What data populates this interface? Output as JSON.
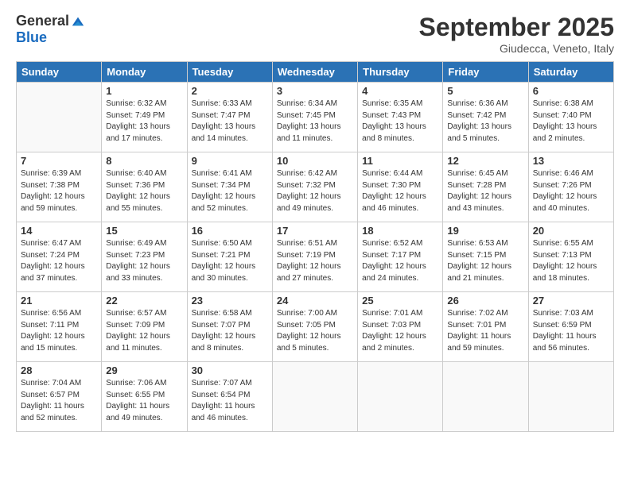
{
  "logo": {
    "general": "General",
    "blue": "Blue"
  },
  "title": "September 2025",
  "location": "Giudecca, Veneto, Italy",
  "headers": [
    "Sunday",
    "Monday",
    "Tuesday",
    "Wednesday",
    "Thursday",
    "Friday",
    "Saturday"
  ],
  "weeks": [
    [
      {
        "day": "",
        "content": ""
      },
      {
        "day": "1",
        "content": "Sunrise: 6:32 AM\nSunset: 7:49 PM\nDaylight: 13 hours\nand 17 minutes."
      },
      {
        "day": "2",
        "content": "Sunrise: 6:33 AM\nSunset: 7:47 PM\nDaylight: 13 hours\nand 14 minutes."
      },
      {
        "day": "3",
        "content": "Sunrise: 6:34 AM\nSunset: 7:45 PM\nDaylight: 13 hours\nand 11 minutes."
      },
      {
        "day": "4",
        "content": "Sunrise: 6:35 AM\nSunset: 7:43 PM\nDaylight: 13 hours\nand 8 minutes."
      },
      {
        "day": "5",
        "content": "Sunrise: 6:36 AM\nSunset: 7:42 PM\nDaylight: 13 hours\nand 5 minutes."
      },
      {
        "day": "6",
        "content": "Sunrise: 6:38 AM\nSunset: 7:40 PM\nDaylight: 13 hours\nand 2 minutes."
      }
    ],
    [
      {
        "day": "7",
        "content": "Sunrise: 6:39 AM\nSunset: 7:38 PM\nDaylight: 12 hours\nand 59 minutes."
      },
      {
        "day": "8",
        "content": "Sunrise: 6:40 AM\nSunset: 7:36 PM\nDaylight: 12 hours\nand 55 minutes."
      },
      {
        "day": "9",
        "content": "Sunrise: 6:41 AM\nSunset: 7:34 PM\nDaylight: 12 hours\nand 52 minutes."
      },
      {
        "day": "10",
        "content": "Sunrise: 6:42 AM\nSunset: 7:32 PM\nDaylight: 12 hours\nand 49 minutes."
      },
      {
        "day": "11",
        "content": "Sunrise: 6:44 AM\nSunset: 7:30 PM\nDaylight: 12 hours\nand 46 minutes."
      },
      {
        "day": "12",
        "content": "Sunrise: 6:45 AM\nSunset: 7:28 PM\nDaylight: 12 hours\nand 43 minutes."
      },
      {
        "day": "13",
        "content": "Sunrise: 6:46 AM\nSunset: 7:26 PM\nDaylight: 12 hours\nand 40 minutes."
      }
    ],
    [
      {
        "day": "14",
        "content": "Sunrise: 6:47 AM\nSunset: 7:24 PM\nDaylight: 12 hours\nand 37 minutes."
      },
      {
        "day": "15",
        "content": "Sunrise: 6:49 AM\nSunset: 7:23 PM\nDaylight: 12 hours\nand 33 minutes."
      },
      {
        "day": "16",
        "content": "Sunrise: 6:50 AM\nSunset: 7:21 PM\nDaylight: 12 hours\nand 30 minutes."
      },
      {
        "day": "17",
        "content": "Sunrise: 6:51 AM\nSunset: 7:19 PM\nDaylight: 12 hours\nand 27 minutes."
      },
      {
        "day": "18",
        "content": "Sunrise: 6:52 AM\nSunset: 7:17 PM\nDaylight: 12 hours\nand 24 minutes."
      },
      {
        "day": "19",
        "content": "Sunrise: 6:53 AM\nSunset: 7:15 PM\nDaylight: 12 hours\nand 21 minutes."
      },
      {
        "day": "20",
        "content": "Sunrise: 6:55 AM\nSunset: 7:13 PM\nDaylight: 12 hours\nand 18 minutes."
      }
    ],
    [
      {
        "day": "21",
        "content": "Sunrise: 6:56 AM\nSunset: 7:11 PM\nDaylight: 12 hours\nand 15 minutes."
      },
      {
        "day": "22",
        "content": "Sunrise: 6:57 AM\nSunset: 7:09 PM\nDaylight: 12 hours\nand 11 minutes."
      },
      {
        "day": "23",
        "content": "Sunrise: 6:58 AM\nSunset: 7:07 PM\nDaylight: 12 hours\nand 8 minutes."
      },
      {
        "day": "24",
        "content": "Sunrise: 7:00 AM\nSunset: 7:05 PM\nDaylight: 12 hours\nand 5 minutes."
      },
      {
        "day": "25",
        "content": "Sunrise: 7:01 AM\nSunset: 7:03 PM\nDaylight: 12 hours\nand 2 minutes."
      },
      {
        "day": "26",
        "content": "Sunrise: 7:02 AM\nSunset: 7:01 PM\nDaylight: 11 hours\nand 59 minutes."
      },
      {
        "day": "27",
        "content": "Sunrise: 7:03 AM\nSunset: 6:59 PM\nDaylight: 11 hours\nand 56 minutes."
      }
    ],
    [
      {
        "day": "28",
        "content": "Sunrise: 7:04 AM\nSunset: 6:57 PM\nDaylight: 11 hours\nand 52 minutes."
      },
      {
        "day": "29",
        "content": "Sunrise: 7:06 AM\nSunset: 6:55 PM\nDaylight: 11 hours\nand 49 minutes."
      },
      {
        "day": "30",
        "content": "Sunrise: 7:07 AM\nSunset: 6:54 PM\nDaylight: 11 hours\nand 46 minutes."
      },
      {
        "day": "",
        "content": ""
      },
      {
        "day": "",
        "content": ""
      },
      {
        "day": "",
        "content": ""
      },
      {
        "day": "",
        "content": ""
      }
    ]
  ]
}
